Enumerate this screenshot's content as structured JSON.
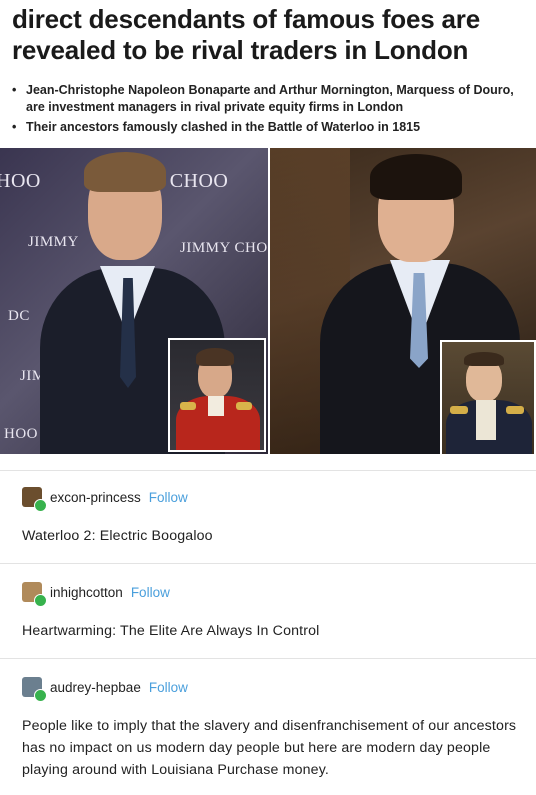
{
  "article": {
    "headline": "direct descendants of famous foes are revealed to be rival traders in London",
    "bullets": [
      "Jean-Christophe Napoleon Bonaparte and Arthur Mornington, Marquess of Douro, are investment managers in rival private equity firms in London",
      "Their ancestors famously clashed in the Battle of Waterloo in 1815"
    ],
    "backdrop_texts": {
      "top_left": "HOO",
      "top_mid": "Y CHOO",
      "mid_left": "JIMMY",
      "mid_right": "JIMMY CHO",
      "lower_left": "DC",
      "lower_mid": "JIM",
      "bottom_left": "HOO"
    }
  },
  "posts": [
    {
      "username": "excon-princess",
      "follow_label": "Follow",
      "text": "Waterloo 2: Electric Boogaloo",
      "avatar_color": "#6b4e2e"
    },
    {
      "username": "inhighcotton",
      "follow_label": "Follow",
      "text": "Heartwarming: The Elite Are Always In Control",
      "avatar_color": "#b08a5a"
    },
    {
      "username": "audrey-hepbae",
      "follow_label": "Follow",
      "text": "People like to imply that the slavery and disenfranchisement of our ancestors has no impact on us modern day people but here are modern day people playing around with Louisiana Purchase money.",
      "avatar_color": "#6b7f8f"
    }
  ],
  "colors": {
    "follow": "#4a9fdc",
    "badge": "#37b24d"
  }
}
